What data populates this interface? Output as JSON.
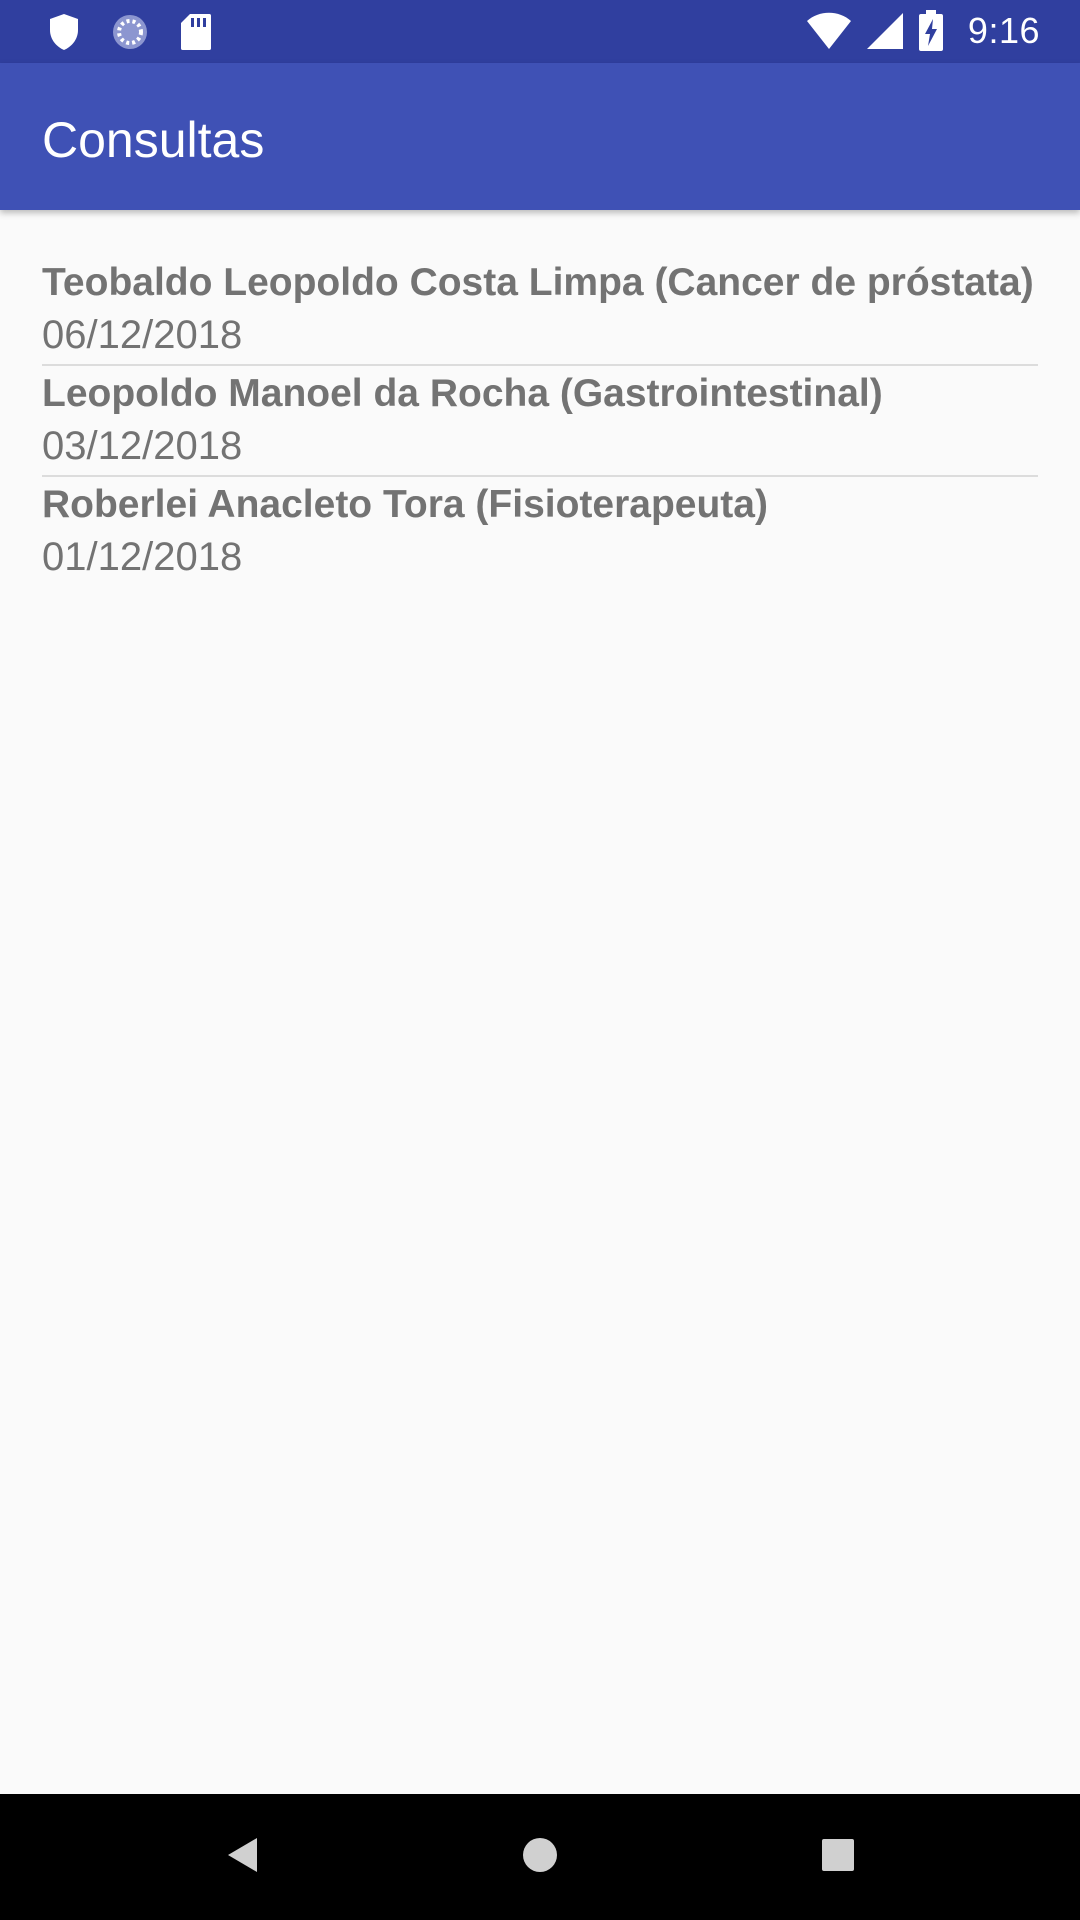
{
  "status_bar": {
    "time": "9:16",
    "left_icons": [
      "shield-icon",
      "sync-icon",
      "sd-card-icon"
    ],
    "right_icons": [
      "wifi-icon",
      "signal-icon",
      "battery-charging-icon"
    ]
  },
  "app_bar": {
    "title": "Consultas"
  },
  "list": {
    "items": [
      {
        "title": "Teobaldo Leopoldo Costa Limpa (Cancer de próstata)",
        "date": "06/12/2018"
      },
      {
        "title": "Leopoldo Manoel da Rocha (Gastrointestinal)",
        "date": "03/12/2018"
      },
      {
        "title": "Roberlei Anacleto Tora (Fisioterapeuta)",
        "date": "01/12/2018"
      }
    ]
  },
  "nav_bar": {
    "buttons": [
      "back-icon",
      "home-icon",
      "recents-icon"
    ]
  },
  "colors": {
    "status_bar": "#303f9f",
    "app_bar": "#3f51b5",
    "background": "#fafafa",
    "item_text": "#737373",
    "divider": "#dcdcdc",
    "nav_bar": "#000000"
  }
}
